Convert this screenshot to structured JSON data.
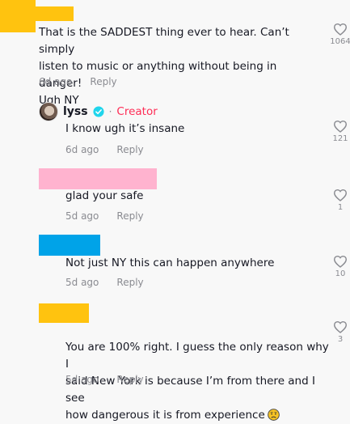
{
  "colors": {
    "redaction_yellow": "#ffc30f",
    "redaction_pink": "#ffb3cf",
    "redaction_blue": "#00a3e8",
    "creator_red": "#fe2c55",
    "verified_blue": "#20d5ec",
    "meta_gray": "#8a8b91"
  },
  "comments": [
    {
      "text": "That is the SADDEST thing ever to hear. Can’t simply\nlisten to music or anything without being in danger!\nUgh NY",
      "time": "6d ago",
      "reply_label": "Reply",
      "likes": "1064",
      "like_icon": "heart-outline-icon"
    },
    {
      "author": "lyss",
      "creator_label": "Creator",
      "separator": "·",
      "text": "I know ugh it’s insane",
      "time": "6d ago",
      "reply_label": "Reply",
      "likes": "121",
      "like_icon": "heart-outline-icon"
    },
    {
      "text": "glad your safe",
      "time": "5d ago",
      "reply_label": "Reply",
      "likes": "1",
      "like_icon": "heart-outline-icon"
    },
    {
      "text": "Not just NY this can happen anywhere",
      "time": "5d ago",
      "reply_label": "Reply",
      "likes": "10",
      "like_icon": "heart-outline-icon"
    },
    {
      "text": "You are 100% right. I guess the only reason why I\nsaid New York is because I’m from there and I see\nhow dangerous it is from experience",
      "emoji": "worried-face-emoji",
      "time": "5d ago",
      "reply_label": "Reply",
      "likes": "3",
      "like_icon": "heart-outline-icon"
    }
  ]
}
